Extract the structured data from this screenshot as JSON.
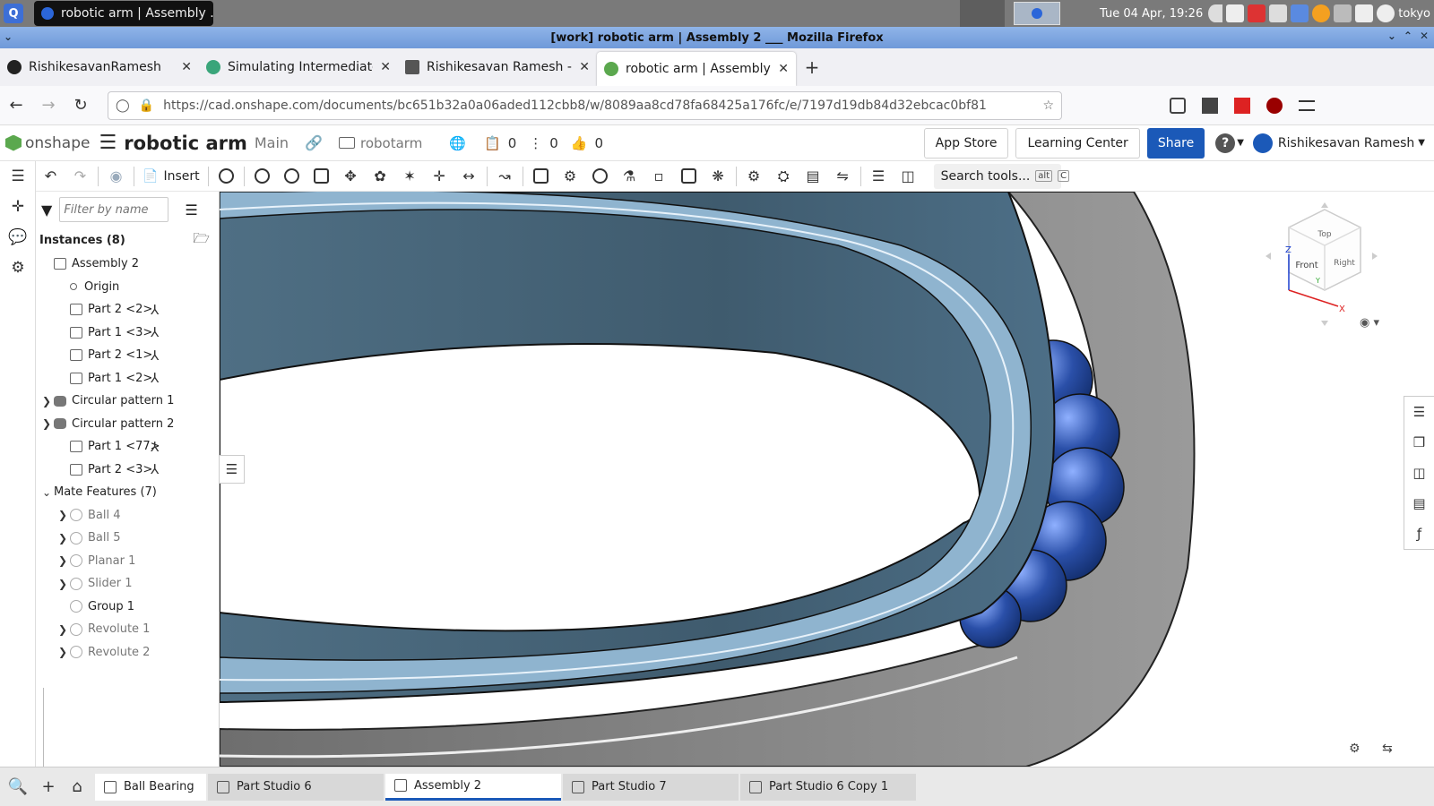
{
  "taskbar": {
    "launcher_label": "Q",
    "window_button": "robotic arm | Assembly ...",
    "clock": "Tue 04 Apr, 19:26",
    "username": "tokyo"
  },
  "window": {
    "title": "[work] robotic arm | Assembly 2 ___ Mozilla Firefox"
  },
  "tabs": [
    {
      "label": "RishikesavanRamesh",
      "icon_color": "#222222"
    },
    {
      "label": "Simulating Intermediate",
      "icon_color": "#3aa57a"
    },
    {
      "label": "Rishikesavan Ramesh - In",
      "icon_color": "#555555"
    },
    {
      "label": "robotic arm | Assembly 2",
      "icon_color": "#5ba84e"
    }
  ],
  "url": "https://cad.onshape.com/documents/bc651b32a0a06aded112cbb8/w/8089aa8cd78fa68425a176fc/e/7197d19db84d32ebcac0bf81",
  "onshape": {
    "logo": "onshape",
    "doc_title": "robotic arm",
    "branch": "Main",
    "folder": "robotarm",
    "versions_count": "0",
    "branches_count": "0",
    "likes_count": "0",
    "app_store": "App Store",
    "learning_center": "Learning Center",
    "share": "Share",
    "user": "Rishikesavan Ramesh",
    "help": "?"
  },
  "toolbar": {
    "insert": "Insert",
    "search": "Search tools...",
    "kbd_alt": "alt",
    "kbd_c": "C"
  },
  "panel": {
    "filter_placeholder": "Filter by name",
    "instances_header": "Instances (8)",
    "tree": [
      {
        "label": "Assembly 2",
        "type": "assembly",
        "indent": 0
      },
      {
        "label": "Origin",
        "type": "origin",
        "indent": 1
      },
      {
        "label": "Part 2 <2>",
        "type": "part",
        "indent": 1,
        "triad": true
      },
      {
        "label": "Part 1 <3>",
        "type": "part",
        "indent": 1,
        "triad": true
      },
      {
        "label": "Part 2 <1>",
        "type": "part",
        "indent": 1,
        "triad": true
      },
      {
        "label": "Part 1 <2>",
        "type": "part",
        "indent": 1,
        "triad": true
      },
      {
        "label": "Circular pattern 1",
        "type": "pattern",
        "indent": 0,
        "caret": ">"
      },
      {
        "label": "Circular pattern 2",
        "type": "pattern",
        "indent": 0,
        "caret": ">"
      },
      {
        "label": "Part 1 <77>",
        "type": "part",
        "indent": 1,
        "triad": true
      },
      {
        "label": "Part 2 <3>",
        "type": "part",
        "indent": 1,
        "triad": true
      },
      {
        "label": "Mate Features (7)",
        "type": "header",
        "indent": 0,
        "caret": "v"
      },
      {
        "label": "Ball 4",
        "type": "mate",
        "indent": 1,
        "caret": ">",
        "dim": true
      },
      {
        "label": "Ball 5",
        "type": "mate",
        "indent": 1,
        "caret": ">",
        "dim": true
      },
      {
        "label": "Planar 1",
        "type": "mate",
        "indent": 1,
        "caret": ">",
        "dim": true
      },
      {
        "label": "Slider 1",
        "type": "mate",
        "indent": 1,
        "caret": ">",
        "dim": true
      },
      {
        "label": "Group 1",
        "type": "mate",
        "indent": 1,
        "dim": false
      },
      {
        "label": "Revolute 1",
        "type": "mate",
        "indent": 1,
        "caret": ">",
        "dim": true
      },
      {
        "label": "Revolute 2",
        "type": "mate",
        "indent": 1,
        "caret": ">",
        "dim": true
      }
    ]
  },
  "viewcube": {
    "top": "Top",
    "front": "Front",
    "right": "Right",
    "axis_z": "Z",
    "axis_y": "Y",
    "axis_x": "X"
  },
  "colors": {
    "ring_inner": "#8fb4cf",
    "ring_inner_dark": "#4d6f87",
    "outer_ring": "#8a8a8a",
    "ball": "#2a4fa8",
    "share": "#1b59b8"
  },
  "bottom_tabs": [
    {
      "label": "Ball Bearing",
      "type": "folder"
    },
    {
      "label": "Part Studio 6",
      "type": "partstudio"
    },
    {
      "label": "Assembly 2",
      "type": "assembly",
      "active": true
    },
    {
      "label": "Part Studio 7",
      "type": "partstudio"
    },
    {
      "label": "Part Studio 6 Copy 1",
      "type": "partstudio"
    }
  ]
}
